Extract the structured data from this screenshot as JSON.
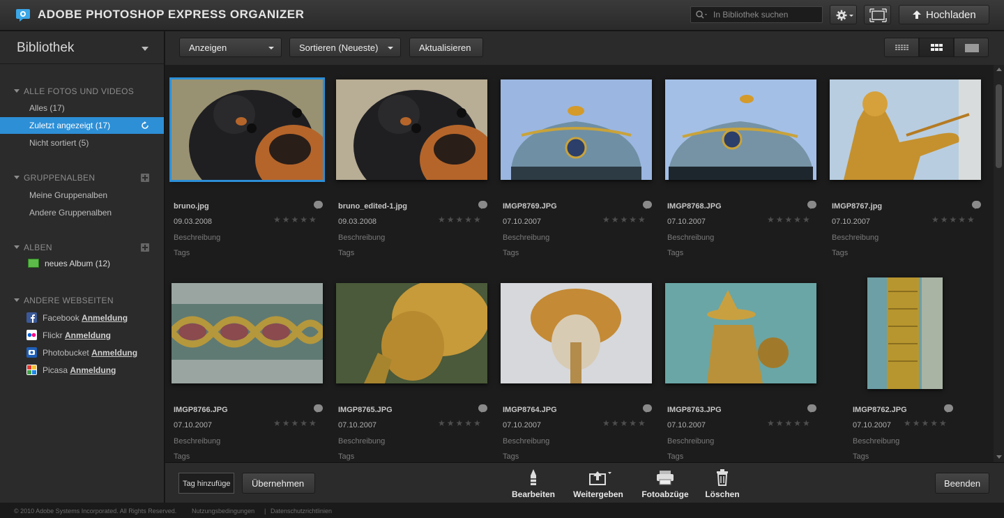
{
  "header": {
    "title": "ADOBE PHOTOSHOP EXPRESS ORGANIZER",
    "search_placeholder": "In Bibliothek suchen",
    "upload_label": "Hochladen"
  },
  "sidebar": {
    "library_title": "Bibliothek",
    "sections": {
      "all": "ALLE FOTOS UND VIDEOS",
      "groups": "GRUPPENALBEN",
      "albums": "ALBEN",
      "sites": "ANDERE WEBSEITEN"
    },
    "all_items": [
      "Alles (17)",
      "Zuletzt angezeigt (17)",
      "Nicht sortiert (5)"
    ],
    "group_items": [
      "Meine Gruppenalben",
      "Andere Gruppenalben"
    ],
    "album_items": [
      "neues Album (12)"
    ],
    "sites": [
      {
        "name": "Facebook",
        "link": "Anmeldung"
      },
      {
        "name": "Flickr",
        "link": "Anmeldung"
      },
      {
        "name": "Photobucket",
        "link": "Anmeldung"
      },
      {
        "name": "Picasa",
        "link": "Anmeldung"
      }
    ]
  },
  "toolbar": {
    "show_label": "Anzeigen",
    "sort_label": "Sortieren (Neueste)",
    "refresh_label": "Aktualisieren"
  },
  "photos": [
    {
      "name": "bruno.jpg",
      "date": "09.03.2008",
      "desc": "Beschreibung",
      "tags": "Tags"
    },
    {
      "name": "bruno_edited-1.jpg",
      "date": "09.03.2008",
      "desc": "Beschreibung",
      "tags": "Tags"
    },
    {
      "name": "IMGP8769.JPG",
      "date": "07.10.2007",
      "desc": "Beschreibung",
      "tags": "Tags"
    },
    {
      "name": "IMGP8768.JPG",
      "date": "07.10.2007",
      "desc": "Beschreibung",
      "tags": "Tags"
    },
    {
      "name": "IMGP8767.jpg",
      "date": "07.10.2007",
      "desc": "Beschreibung",
      "tags": "Tags"
    },
    {
      "name": "IMGP8766.JPG",
      "date": "07.10.2007",
      "desc": "Beschreibung",
      "tags": "Tags"
    },
    {
      "name": "IMGP8765.JPG",
      "date": "07.10.2007",
      "desc": "Beschreibung",
      "tags": "Tags"
    },
    {
      "name": "IMGP8764.JPG",
      "date": "07.10.2007",
      "desc": "Beschreibung",
      "tags": "Tags"
    },
    {
      "name": "IMGP8763.JPG",
      "date": "07.10.2007",
      "desc": "Beschreibung",
      "tags": "Tags"
    },
    {
      "name": "IMGP8762.JPG",
      "date": "07.10.2007",
      "desc": "Beschreibung",
      "tags": "Tags"
    }
  ],
  "bottombar": {
    "tag_input": "Tag hinzufüge",
    "apply_label": "Übernehmen",
    "actions": [
      "Bearbeiten",
      "Weitergeben",
      "Fotoabzüge",
      "Löschen"
    ],
    "exit_label": "Beenden"
  },
  "footer": {
    "copyright": "© 2010 Adobe Systems Incorporated. All Rights Reserved.",
    "terms": "Nutzungsbedingungen",
    "separator": "|",
    "privacy": "Datenschutzrichtlinien"
  },
  "colors": {
    "accent": "#2d8fd6",
    "background": "#1c1c1c",
    "panel": "#2b2b2b"
  }
}
